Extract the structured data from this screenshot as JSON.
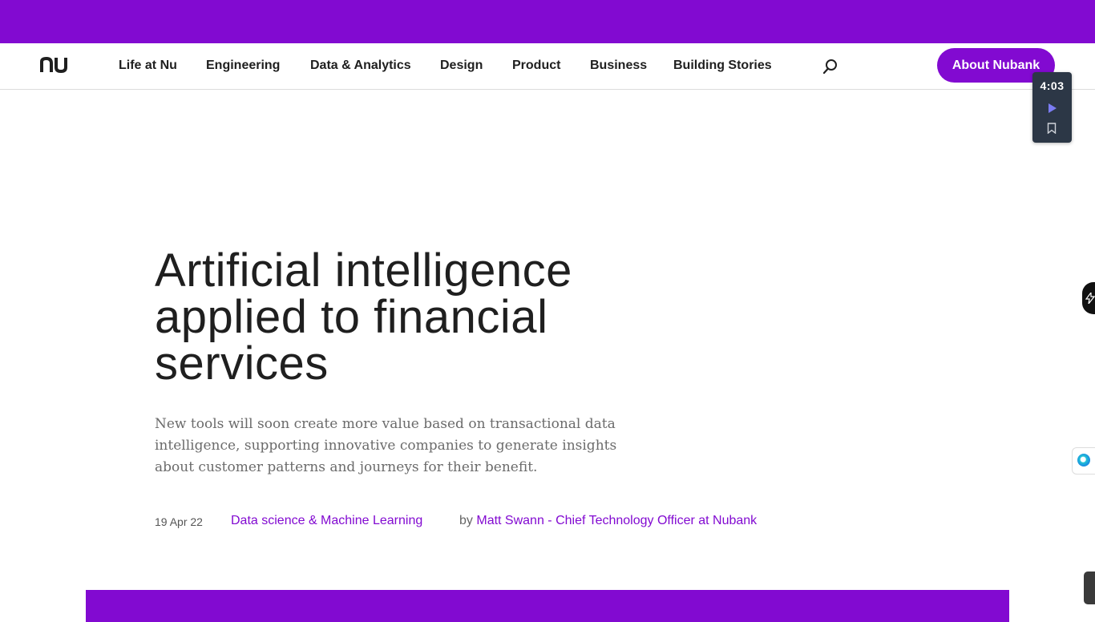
{
  "logo": {
    "label": "nu"
  },
  "nav": {
    "items": [
      {
        "label": "Life at Nu"
      },
      {
        "label": "Engineering"
      },
      {
        "label": "Data & Analytics"
      },
      {
        "label": "Design"
      },
      {
        "label": "Product"
      },
      {
        "label": "Business"
      },
      {
        "label": "Building Stories"
      }
    ],
    "about_label": "About Nubank"
  },
  "reading_widget": {
    "time": "4:03"
  },
  "article": {
    "title": "Artificial intelligence applied to financial services",
    "subtitle": "New tools will soon create more value based on transactional data intelligence, supporting innovative companies to generate insights about customer patterns and journeys for their benefit.",
    "date": "19 Apr 22",
    "category": "Data science & Machine Learning",
    "by_prefix": "by",
    "author": "Matt Swann - Chief Technology Officer at Nubank"
  },
  "icons": {
    "logo": "nu-logo-icon",
    "search": "search-icon",
    "play": "play-icon",
    "bookmark": "bookmark-icon",
    "side_tab": "lightning-icon",
    "assistant": "assistant-icon"
  },
  "colors": {
    "brand": "#820ad1",
    "text": "#1f1f1f",
    "widget": "#2c3746"
  }
}
